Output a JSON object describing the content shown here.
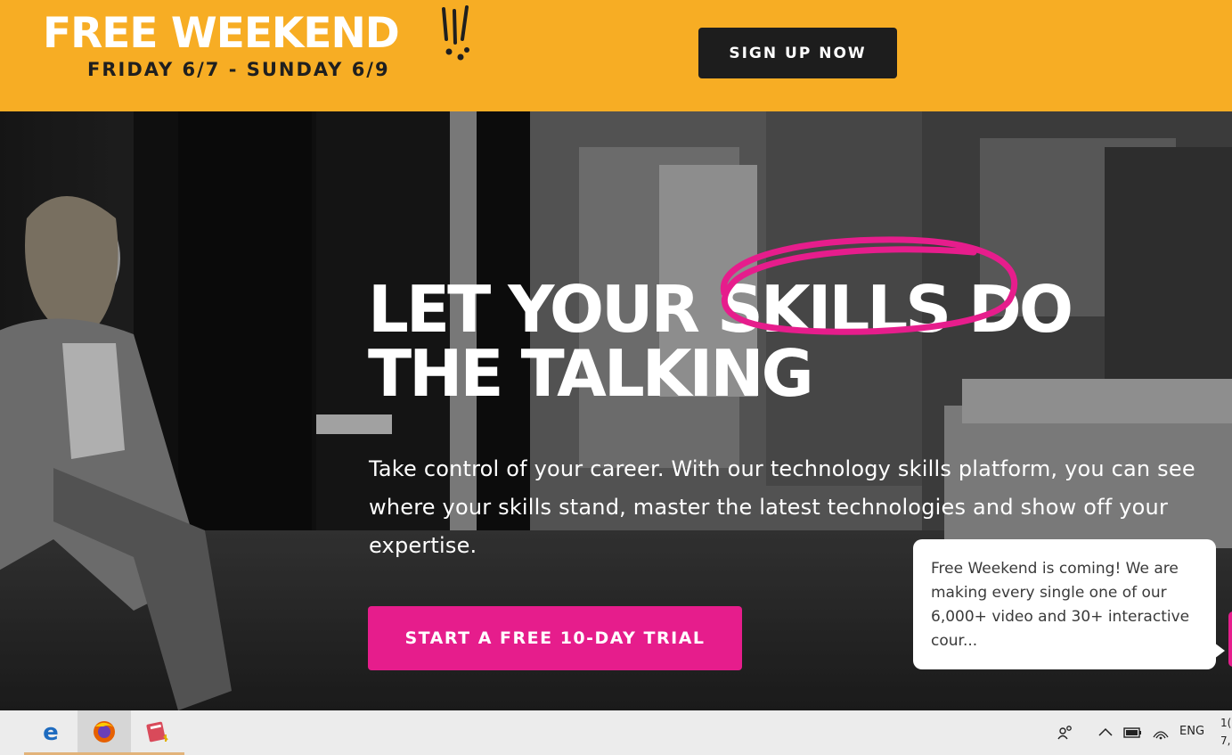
{
  "promo": {
    "title": "FREE WEEKEND",
    "dates": "FRIDAY 6/7 - SUNDAY 6/9",
    "signup_label": "SIGN UP NOW",
    "colors": {
      "background": "#f7ad24",
      "button": "#1d1d1d"
    }
  },
  "hero": {
    "headline_part1": "LET YOUR ",
    "headline_highlight": "SKILLS",
    "headline_part2": " DO",
    "headline_line2": "THE TALKING",
    "body": "Take control of your career. With our technology skills platform, you can see where your skills stand, master the latest technologies and show off your expertise.",
    "cta_label": "START A FREE 10-DAY TRIAL",
    "colors": {
      "accent": "#e61d8c",
      "text": "#ffffff"
    }
  },
  "chat": {
    "message": "Free Weekend is coming! We are making every single one of our 6,000+ video and 30+ interactive cour..."
  },
  "taskbar": {
    "apps": [
      {
        "icon": "start-icon"
      },
      {
        "icon": "edge-icon"
      },
      {
        "icon": "firefox-icon"
      },
      {
        "icon": "notebook-app-icon"
      }
    ],
    "tray": {
      "icons": [
        "people-icon",
        "chevron-up-icon",
        "battery-icon",
        "wifi-icon"
      ],
      "language": "ENG",
      "clock_line1": "1(",
      "clock_line2": "7,"
    }
  }
}
